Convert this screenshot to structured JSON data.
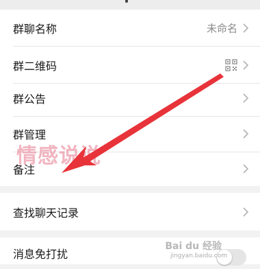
{
  "settings": {
    "group_name_label": "群聊名称",
    "group_name_value": "未命名",
    "qr_label": "群二维码",
    "announcement_label": "群公告",
    "manage_label": "群管理",
    "remark_label": "备注",
    "search_history_label": "查找聊天记录",
    "mute_label": "消息免打扰"
  },
  "watermark_text": "情感说说",
  "baidu_watermark": "Bai du 经验",
  "baidu_url": "jingyan.baidu.com",
  "colors": {
    "background": "#f2f2f2",
    "row_background": "#ffffff",
    "arrow": "#e8333a",
    "chevron": "#b2b2b2"
  },
  "icons": {
    "chevron": "chevron-right-icon",
    "qr": "qr-code-icon"
  },
  "mute_enabled": false
}
